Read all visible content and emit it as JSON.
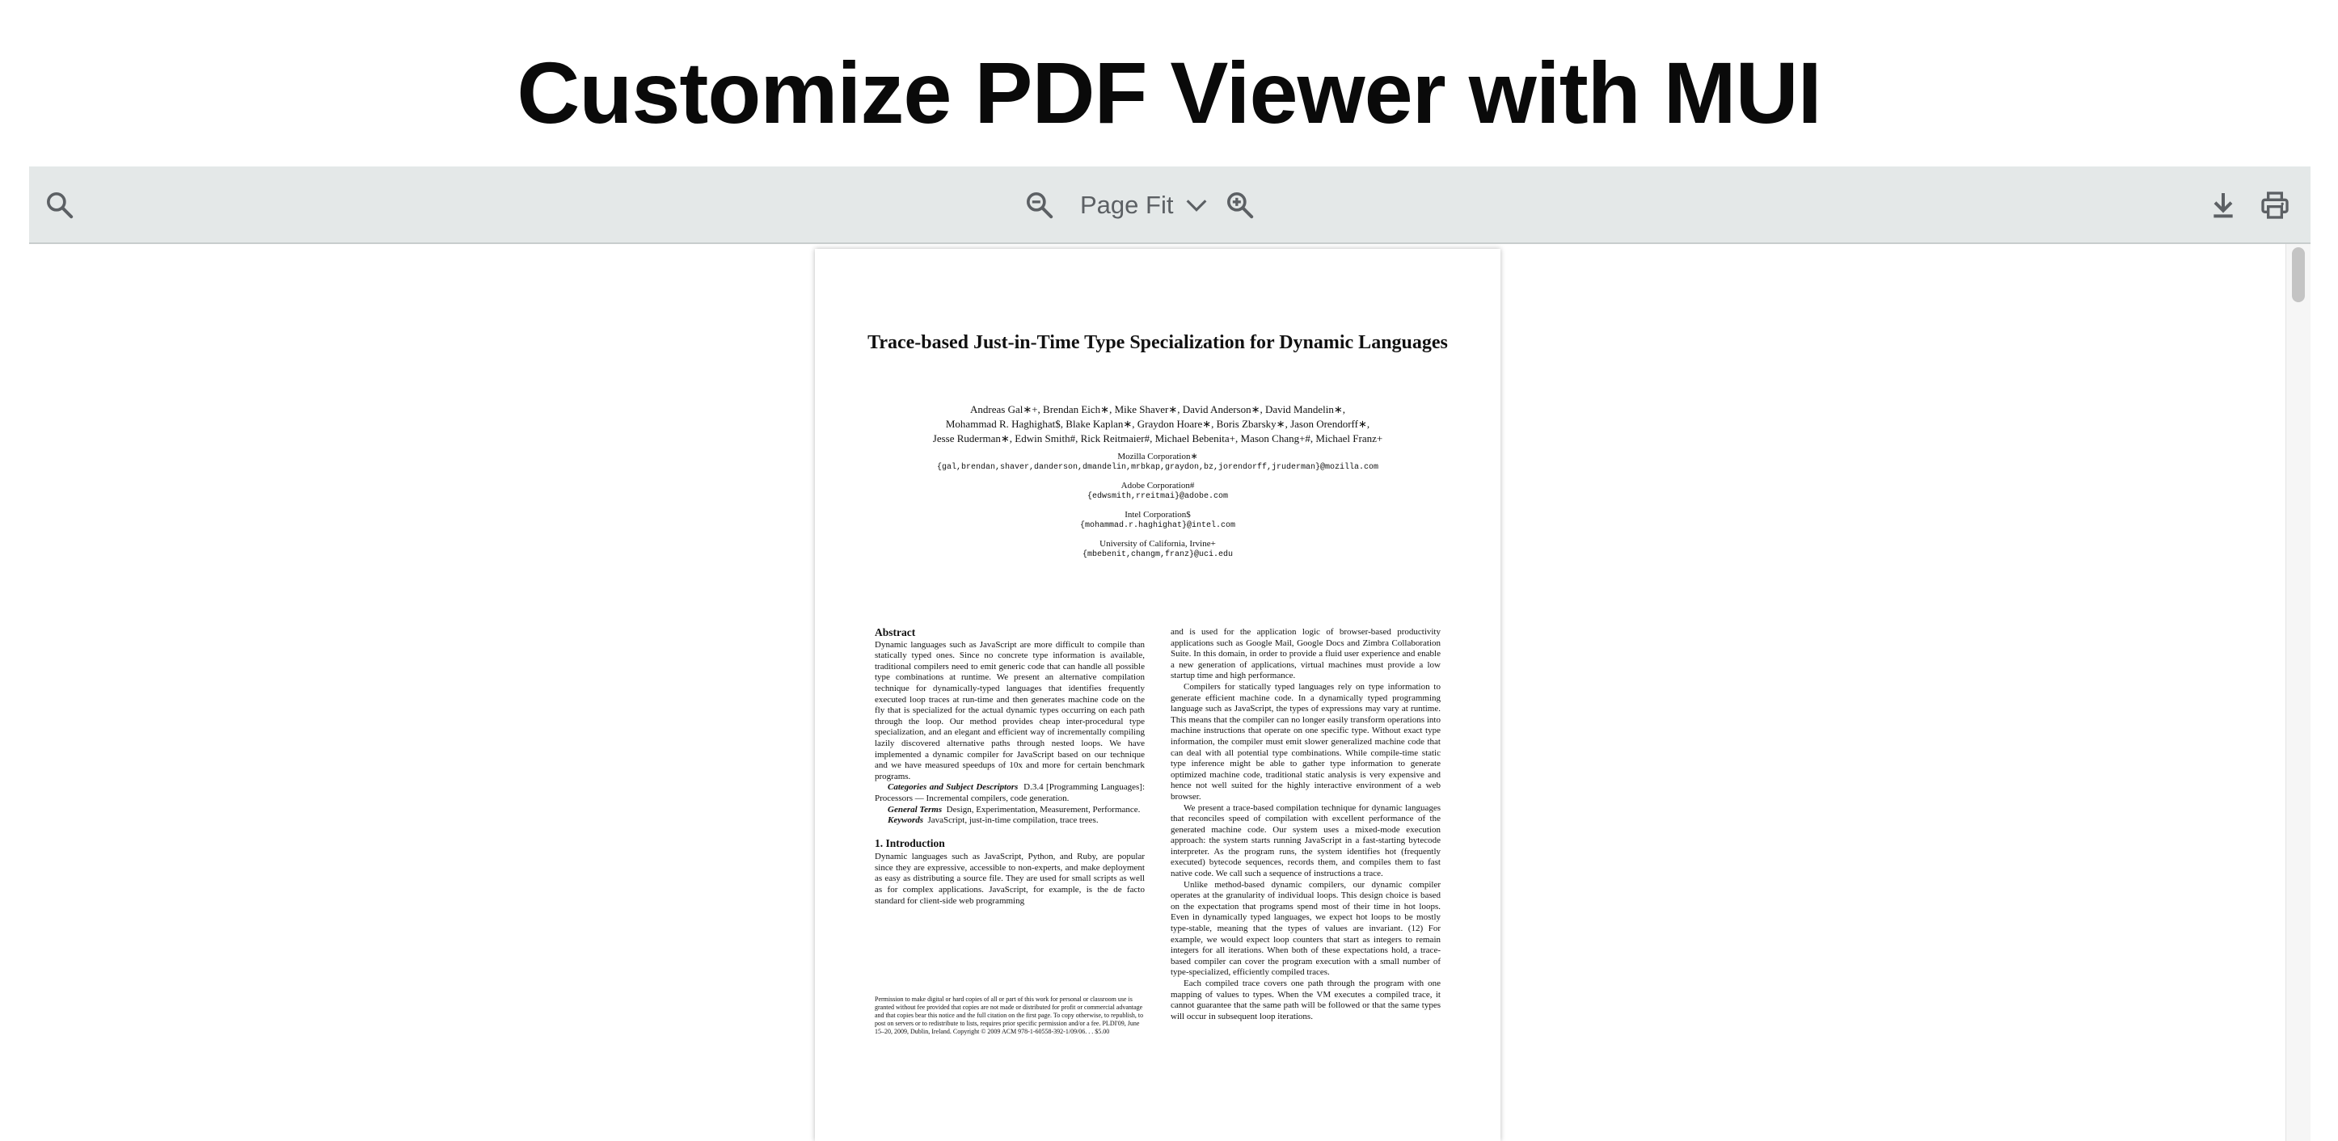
{
  "header": {
    "title": "Customize PDF Viewer with MUI"
  },
  "toolbar": {
    "search_icon": "search-icon",
    "zoom_out_icon": "zoom-out-icon",
    "zoom_level": "Page Fit",
    "zoom_in_icon": "zoom-in-icon",
    "download_icon": "download-icon",
    "print_icon": "print-icon"
  },
  "document": {
    "title": "Trace-based Just-in-Time Type Specialization for Dynamic Languages",
    "authors_line1": "Andreas Gal∗+, Brendan Eich∗, Mike Shaver∗, David Anderson∗, David Mandelin∗,",
    "authors_line2": "Mohammad R. Haghighat$, Blake Kaplan∗, Graydon Hoare∗, Boris Zbarsky∗, Jason Orendorff∗,",
    "authors_line3": "Jesse Ruderman∗, Edwin Smith#, Rick Reitmaier#, Michael Bebenita+, Mason Chang+#, Michael Franz+",
    "affiliations": [
      {
        "name": "Mozilla Corporation∗",
        "email": "{gal,brendan,shaver,danderson,dmandelin,mrbkap,graydon,bz,jorendorff,jruderman}@mozilla.com"
      },
      {
        "name": "Adobe Corporation#",
        "email": "{edwsmith,rreitmai}@adobe.com"
      },
      {
        "name": "Intel Corporation$",
        "email": "{mohammad.r.haghighat}@intel.com"
      },
      {
        "name": "University of California, Irvine+",
        "email": "{mbebenit,changm,franz}@uci.edu"
      }
    ],
    "abstract_heading": "Abstract",
    "abstract_text": "Dynamic languages such as JavaScript are more difficult to compile than statically typed ones. Since no concrete type information is available, traditional compilers need to emit generic code that can handle all possible type combinations at runtime. We present an alternative compilation technique for dynamically-typed languages that identifies frequently executed loop traces at run-time and then generates machine code on the fly that is specialized for the actual dynamic types occurring on each path through the loop. Our method provides cheap inter-procedural type specialization, and an elegant and efficient way of incrementally compiling lazily discovered alternative paths through nested loops. We have implemented a dynamic compiler for JavaScript based on our technique and we have measured speedups of 10x and more for certain benchmark programs.",
    "categories_label": "Categories and Subject Descriptors",
    "categories_text": "D.3.4 [Programming Languages]: Processors — Incremental compilers, code generation.",
    "general_label": "General Terms",
    "general_text": "Design, Experimentation, Measurement, Performance.",
    "keywords_label": "Keywords",
    "keywords_text": "JavaScript, just-in-time compilation, trace trees.",
    "intro_heading": "1.   Introduction",
    "intro_text": "Dynamic languages such as JavaScript, Python, and Ruby, are popular since they are expressive, accessible to non-experts, and make deployment as easy as distributing a source file. They are used for small scripts as well as for complex applications. JavaScript, for example, is the de facto standard for client-side web programming",
    "footnote": "Permission to make digital or hard copies of all or part of this work for personal or classroom use is granted without fee provided that copies are not made or distributed for profit or commercial advantage and that copies bear this notice and the full citation on the first page. To copy otherwise, to republish, to post on servers or to redistribute to lists, requires prior specific permission and/or a fee. PLDI'09,   June 15–20, 2009, Dublin, Ireland. Copyright © 2009 ACM 978-1-60558-392-1/09/06. . . $5.00",
    "right_col_p1": "and is used for the application logic of browser-based productivity applications such as Google Mail, Google Docs and Zimbra Collaboration Suite. In this domain, in order to provide a fluid user experience and enable a new generation of applications, virtual machines must provide a low startup time and high performance.",
    "right_col_p2": "Compilers for statically typed languages rely on type information to generate efficient machine code. In a dynamically typed programming language such as JavaScript, the types of expressions may vary at runtime. This means that the compiler can no longer easily transform operations into machine instructions that operate on one specific type. Without exact type information, the compiler must emit slower generalized machine code that can deal with all potential type combinations. While compile-time static type inference might be able to gather type information to generate optimized machine code, traditional static analysis is very expensive and hence not well suited for the highly interactive environment of a web browser.",
    "right_col_p3": "We present a trace-based compilation technique for dynamic languages that reconciles speed of compilation with excellent performance of the generated machine code. Our system uses a mixed-mode execution approach: the system starts running JavaScript in a fast-starting bytecode interpreter. As the program runs, the system identifies hot (frequently executed) bytecode sequences, records them, and compiles them to fast native code. We call such a sequence of instructions a trace.",
    "right_col_p4": "Unlike method-based dynamic compilers, our dynamic compiler operates at the granularity of individual loops. This design choice is based on the expectation that programs spend most of their time in hot loops. Even in dynamically typed languages, we expect hot loops to be mostly type-stable, meaning that the types of values are invariant. (12) For example, we would expect loop counters that start as integers to remain integers for all iterations. When both of these expectations hold, a trace-based compiler can cover the program execution with a small number of type-specialized, efficiently compiled traces.",
    "right_col_p5": "Each compiled trace covers one path through the program with one mapping of values to types. When the VM executes a compiled trace, it cannot guarantee that the same path will be followed or that the same types will occur in subsequent loop iterations."
  }
}
